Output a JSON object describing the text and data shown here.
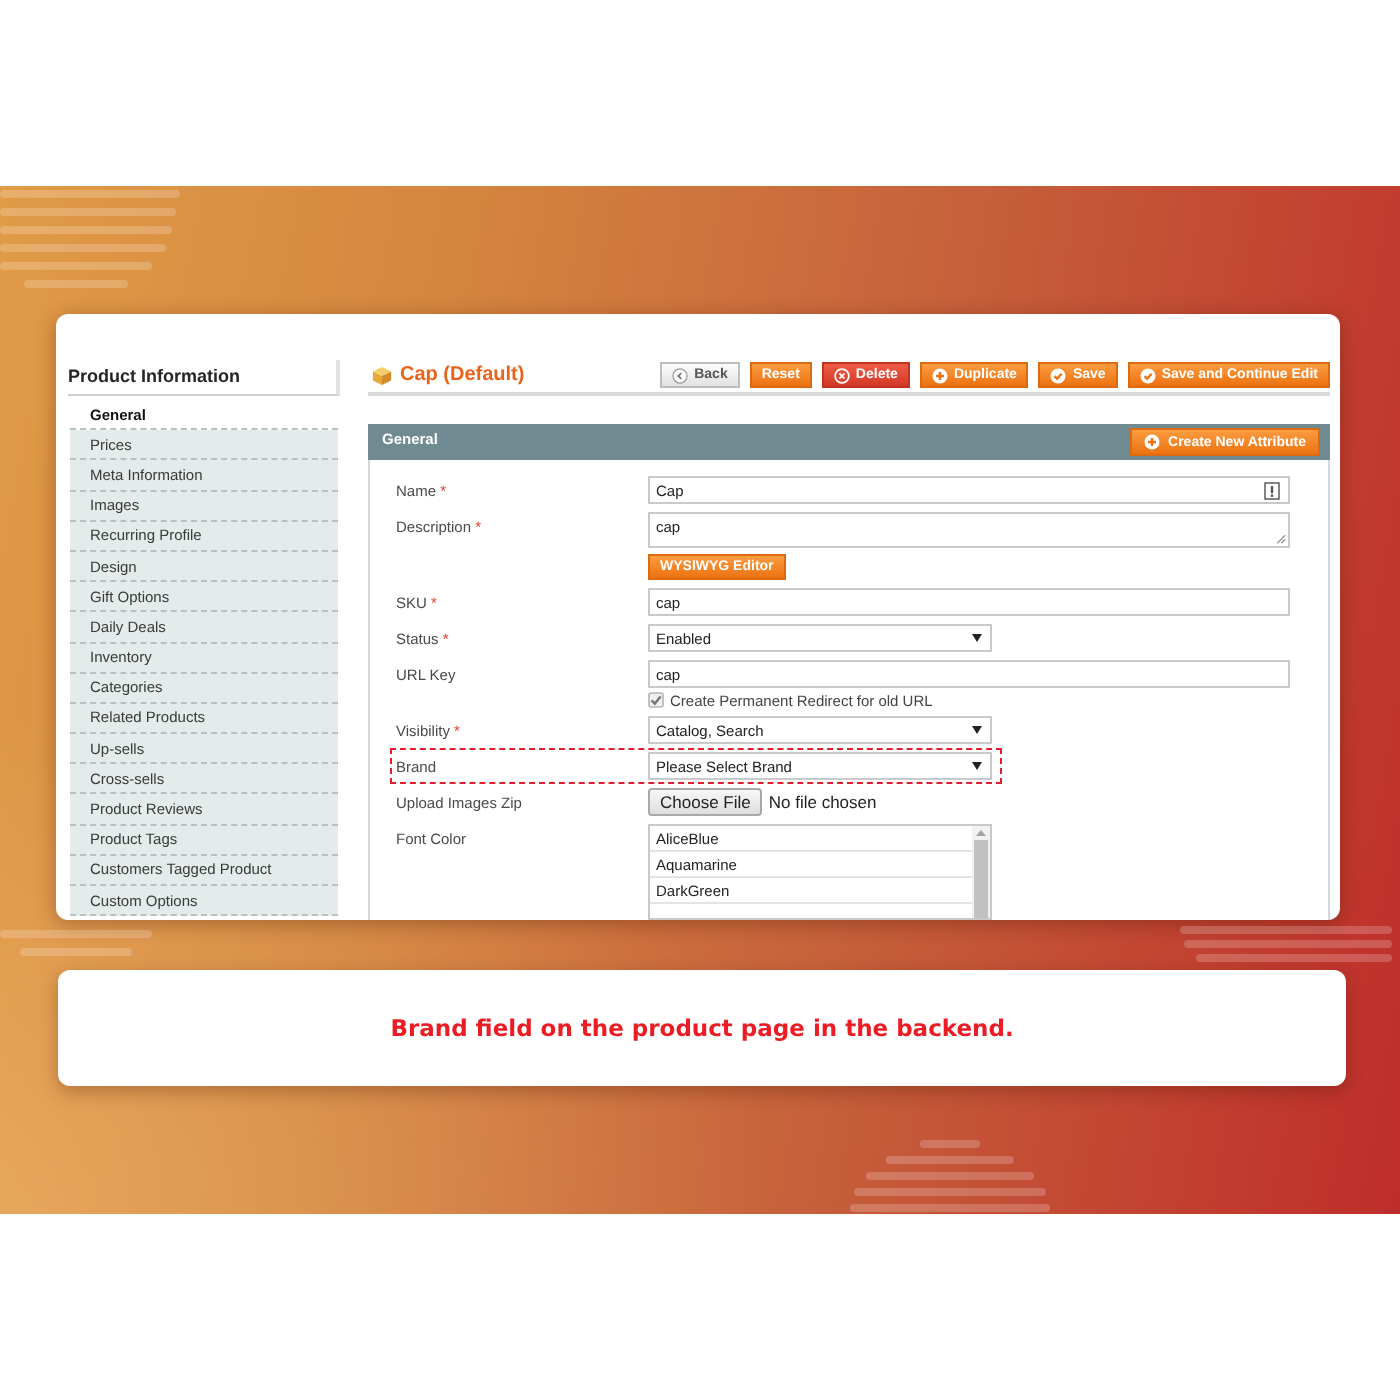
{
  "sidebar": {
    "title": "Product Information",
    "items": [
      {
        "label": "General",
        "selected": true
      },
      {
        "label": "Prices",
        "selected": false
      },
      {
        "label": "Meta Information",
        "selected": false
      },
      {
        "label": "Images",
        "selected": false
      },
      {
        "label": "Recurring Profile",
        "selected": false
      },
      {
        "label": "Design",
        "selected": false
      },
      {
        "label": "Gift Options",
        "selected": false
      },
      {
        "label": "Daily Deals",
        "selected": false
      },
      {
        "label": "Inventory",
        "selected": false
      },
      {
        "label": "Categories",
        "selected": false
      },
      {
        "label": "Related Products",
        "selected": false
      },
      {
        "label": "Up-sells",
        "selected": false
      },
      {
        "label": "Cross-sells",
        "selected": false
      },
      {
        "label": "Product Reviews",
        "selected": false
      },
      {
        "label": "Product Tags",
        "selected": false
      },
      {
        "label": "Customers Tagged Product",
        "selected": false
      },
      {
        "label": "Custom Options",
        "selected": false
      }
    ]
  },
  "header": {
    "title": "Cap (Default)",
    "buttons": [
      {
        "kind": "back",
        "label": "Back"
      },
      {
        "kind": "reset",
        "label": "Reset"
      },
      {
        "kind": "delete",
        "label": "Delete"
      },
      {
        "kind": "duplicate",
        "label": "Duplicate"
      },
      {
        "kind": "save",
        "label": "Save"
      },
      {
        "kind": "save_continue",
        "label": "Save and Continue Edit"
      }
    ]
  },
  "section": {
    "title": "General",
    "button": {
      "kind": "add",
      "label": "Create New Attribute"
    }
  },
  "form": {
    "rows": [
      {
        "kind": "text_notice",
        "label": "Name",
        "required_mark": "*",
        "value": "Cap",
        "highlighted": false
      },
      {
        "kind": "textarea",
        "label": "Description",
        "required_mark": "*",
        "value": "cap",
        "editor_button": "WYSIWYG Editor",
        "highlighted": false
      },
      {
        "kind": "text",
        "label": "SKU",
        "required_mark": "*",
        "value": "cap",
        "highlighted": false
      },
      {
        "kind": "select",
        "label": "Status",
        "required_mark": "*",
        "value": "Enabled",
        "highlighted": false
      },
      {
        "kind": "text",
        "label": "URL Key",
        "value": "cap",
        "checkbox": {
          "label": "Create Permanent Redirect for old URL",
          "checked": true
        },
        "highlighted": false
      },
      {
        "kind": "select",
        "label": "Visibility",
        "required_mark": "*",
        "value": "Catalog, Search",
        "highlighted": false
      },
      {
        "kind": "select",
        "label": "Brand",
        "value": "Please Select Brand",
        "highlighted": true
      },
      {
        "kind": "file",
        "label": "Upload Images Zip",
        "button": "Choose File",
        "status": "No file chosen",
        "highlighted": false
      },
      {
        "kind": "multiselect",
        "label": "Font Color",
        "options": [
          {
            "label": "AliceBlue",
            "selected": false
          },
          {
            "label": "Aquamarine",
            "selected": false
          },
          {
            "label": "DarkGreen",
            "selected": false
          }
        ],
        "highlighted": false
      }
    ]
  },
  "caption": "Brand field on the product page in the backend."
}
